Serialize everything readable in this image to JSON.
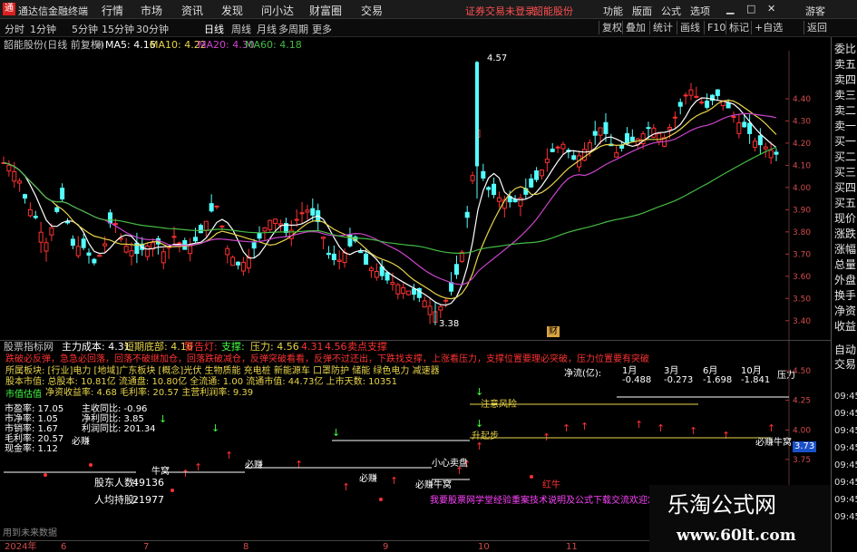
{
  "app_title": "通达信金融终端",
  "menu": [
    "行情",
    "市场",
    "资讯",
    "发现",
    "问小达",
    "财富圈",
    "交易"
  ],
  "login_status": "证券交易未登录",
  "stock_name_red": "韶能股份",
  "top_right": [
    "功能",
    "版面",
    "公式",
    "选项"
  ],
  "guest": "游客",
  "periods": [
    "分时",
    "1分钟",
    "5分钟",
    "15分钟",
    "30分钟",
    "日线",
    "周线",
    "月线",
    "多周期",
    "更多"
  ],
  "right_tools": [
    "复权",
    "叠加",
    "统计",
    "画线",
    "F10",
    "标记",
    "+自选",
    "返回"
  ],
  "chart_header": {
    "title": "韶能股份(日线 前复权)",
    "ma5": "MA5: 4.16",
    "ma10": "MA10: 4.22",
    "ma20": "MA20: 4.30",
    "ma60": "MA60: 4.18"
  },
  "colors": {
    "up": "#ff3232",
    "down": "#54ffff",
    "ma5": "#ffffff",
    "ma10": "#e8d44a",
    "ma20": "#cc44cc",
    "ma60": "#44bb44"
  },
  "price_axis": [
    "4.40",
    "4.30",
    "4.20",
    "4.10",
    "4.00",
    "3.90",
    "3.80",
    "3.70",
    "3.60",
    "3.50",
    "3.40"
  ],
  "annotations": {
    "high": "4.57",
    "low": "3.38",
    "badge": "财"
  },
  "indicator_header": {
    "name": "股票指标网",
    "a": "主力成本: 4.31",
    "b": "短期底部: 4.16",
    "c": "警告灯:",
    "d": "支撑:",
    "e": "压力: 4.56",
    "f": "4.31",
    "g": "4.56",
    "h": "卖点支撑"
  },
  "notice_text": "跌破必反弹，急急必回落，回落不破继加仓，回落跌破减仓，反弹突破看看，反弹不过还出，下跌找支撑，上涨看压力，支撑位置要理必突破，压力位置要有突破",
  "info": {
    "row1": "所属板块: [行业]电力 [地域]广东板块 [概念]光伏 生物质能 充电桩 新能源车 口罩防护 储能 绿色电力 减速器",
    "row2": "股本市值: 总股本: 10.81亿 流通盘: 10.80亿 全流通: 1.00 流通市值: 44.73亿 上市天数: 10351",
    "row3": "净资收益率: 4.68 毛利率: 20.57 主营利润率: 9.39",
    "row4": "市值估值"
  },
  "netflow": {
    "label": "净流(亿):",
    "m1": "1月",
    "m1v": "-0.488",
    "m3": "3月",
    "m3v": "-0.273",
    "m6": "6月",
    "m6v": "-1.698",
    "m10": "10月",
    "m10v": "-1.841",
    "yl": "压力"
  },
  "stats": {
    "pe": "市盈率: 17.05",
    "pb": "市净率: 1.05",
    "ps": "市销率: 1.67",
    "mll": "毛利率: 20.57",
    "cash": "现金率: 1.12",
    "rev": "主收同比: -0.96",
    "netp": "净利同比: 3.85",
    "profit": "利润同比: 201.34",
    "holders_label": "股东人数:",
    "holders": "49136",
    "avg_label": "人均持股:",
    "avg": "21977"
  },
  "signals": {
    "buy_pos": "注意风险",
    "up_step": "升起步",
    "xin": "小心卖盘",
    "bi1": "必赚",
    "bi2": "必赚",
    "bi3": "必赚",
    "bi4": "必赚牛窝",
    "niu": "红牛",
    "niuwo1": "牛窝",
    "niuwo2": "必赚牛窝",
    "nuan": "必赚牛窝"
  },
  "magenta_note": "我要股票网学堂经验重案技术说明及公式下载交流欢迎您的参与",
  "ind_axis": [
    "4.50",
    "4.25",
    "4.00",
    "3.75",
    "3.50"
  ],
  "ind_value": "3.73",
  "date_axis": [
    "2024年",
    "6",
    "7",
    "8",
    "9",
    "10",
    "11"
  ],
  "bottom_left": "用到未来数据",
  "side_panel": [
    "委比",
    "卖五",
    "卖四",
    "卖三",
    "卖二",
    "卖一",
    "买一",
    "买二",
    "买三",
    "买四",
    "买五",
    "现价",
    "涨跌",
    "涨幅",
    "总量",
    "外盘",
    "换手",
    "净资",
    "收益"
  ],
  "side_panel2": [
    "自动",
    "交易"
  ],
  "times": [
    "09:45",
    "09:45",
    "09:45",
    "09:45",
    "09:45",
    "09:45",
    "09:45",
    "09:45"
  ],
  "watermark": {
    "line1": "乐淘公式网",
    "line2": "www.60lt.com"
  }
}
